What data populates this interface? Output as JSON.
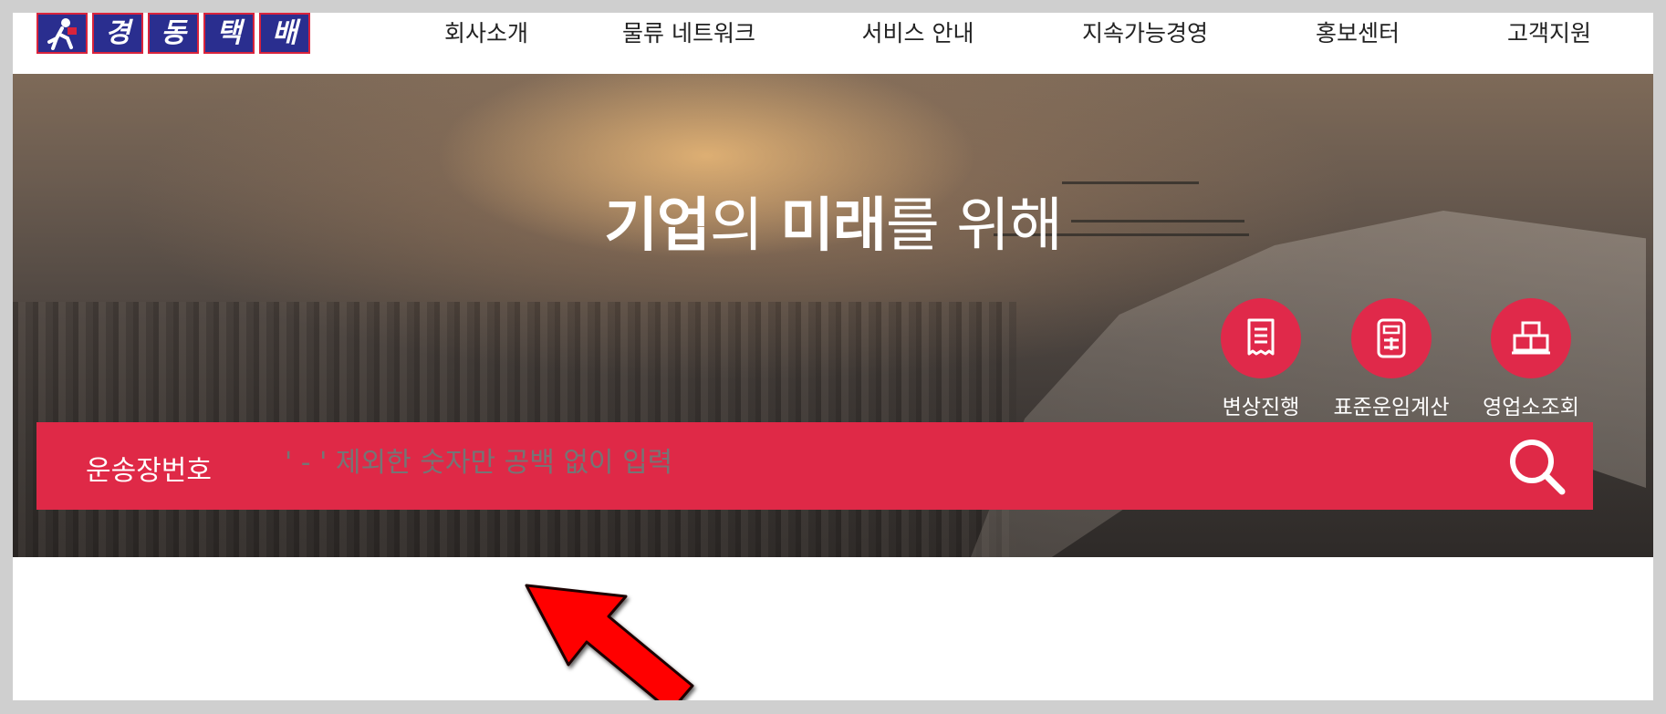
{
  "brand": {
    "logo_chars": [
      "경",
      "동",
      "택",
      "배"
    ],
    "colors": {
      "blue": "#2a2e8f",
      "red": "#df2947"
    }
  },
  "nav": {
    "items": [
      {
        "label": "회사소개"
      },
      {
        "label": "물류 네트워크"
      },
      {
        "label": "서비스 안내"
      },
      {
        "label": "지속가능경영"
      },
      {
        "label": "홍보센터"
      },
      {
        "label": "고객지원"
      }
    ]
  },
  "hero": {
    "tagline_parts": {
      "w1": "기업",
      "w2": "의 ",
      "w3": "미래",
      "w4": "를 위해"
    }
  },
  "quick_links": [
    {
      "label": "변상진행",
      "icon": "receipt-icon"
    },
    {
      "label": "표준운임계산",
      "icon": "calculator-icon"
    },
    {
      "label": "영업소조회",
      "icon": "branch-boxes-icon"
    }
  ],
  "search": {
    "label": "운송장번호",
    "placeholder": "' - ' 제외한 숫자만 공백 없이 입력",
    "icon": "search-icon"
  },
  "annotation": {
    "icon": "red-arrow-pointer-icon",
    "color": "#ff0000"
  }
}
